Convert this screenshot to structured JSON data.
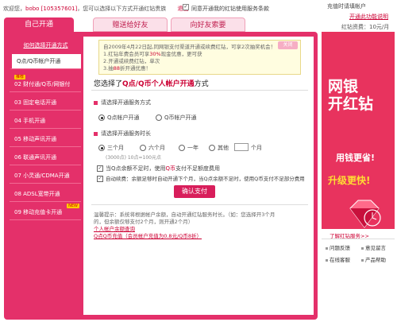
{
  "top": {
    "welcome_prefix": "欢迎您，",
    "user": "bobo [105357601]",
    "welcome_suffix": "，您可以选择以下方式开通红钻贵族",
    "logout": "退出",
    "sync_checked": "✓",
    "sync_label": "同意开通我的红钻使用服务条款",
    "right_line1": "充值时请填帐户",
    "right_line2": "开通此功能说明",
    "right_line3": "红钻资费：10元/月"
  },
  "tabs": [
    "自己开通",
    "赠送给好友",
    "向好友索要"
  ],
  "sidebar": {
    "title": "如何选择开通方式",
    "items": [
      {
        "label": "Q点/Q币帐户开通",
        "badge": ""
      },
      {
        "label": "02 财付通/Q币/网银付",
        "badge": "推荐"
      },
      {
        "label": "03 固定电话开通",
        "badge": ""
      },
      {
        "label": "04 手机开通",
        "badge": ""
      },
      {
        "label": "05 移动声讯开通",
        "badge": ""
      },
      {
        "label": "06 联通声讯开通",
        "badge": ""
      },
      {
        "label": "07 小灵通/CDMA开通",
        "badge": ""
      },
      {
        "label": "08 ADSL宽带开通",
        "badge": ""
      },
      {
        "label": "09 移动充值卡开通",
        "badge": "NEW"
      }
    ]
  },
  "notice": {
    "line1": "自2009年4月22日起,同网银支付渠道开通或续费红钻，可享2次抽奖机会！",
    "line2a": "1.红钻年费会员可享",
    "line2b": "30%",
    "line2c": "现金优惠，更可获",
    "line3": "2.开通或续费红钻，单次",
    "line4": "3.抽",
    "line4b": "88",
    "line4c": "折开通优惠！",
    "close": "关闭"
  },
  "heading": {
    "prefix": "您选择了",
    "highlight": "Q点/Q币个人帐户开通",
    "suffix": "方式"
  },
  "service": {
    "title": "请选择开通服务方式",
    "opt1": "Q点帐户开通",
    "opt2": "Q币帐户开通"
  },
  "duration": {
    "title": "请选择开通服务时长",
    "opts": [
      "三个月",
      "六个月",
      "一年",
      "其他"
    ],
    "unit": "个月",
    "price_note": "(3000点) 10点=100元点"
  },
  "checks": {
    "c1_prefix": "当Q点余额不足时，使用",
    "c1_red": "Q币",
    "c1_suffix": "支付不足额度费用",
    "c2": "自动续费：余额足够时自动开通下个月，当Q点余额不足时，使用Q币支付不足部分费用"
  },
  "confirm": "确认支付",
  "tip": {
    "line1": "温馨提示：系统将根据帐户余额，自动开通红钻服务时长。（如：您选择开3个月",
    "line2": "的，但余额仅够支付2个月，则开通2个月）",
    "link1": "个人帐户余额查询",
    "line3": "Q点Q币充值（会员帐户充值为0.8元/Q币8折）"
  },
  "ad": {
    "line1": "网银",
    "line2": "开红钻",
    "line3": "用钱更省!",
    "line4": "升级更快!",
    "caption": "了解红钻服务>>"
  },
  "right_links": [
    "问题反馈",
    "意见留言",
    "在线客服",
    "产品帮助"
  ]
}
